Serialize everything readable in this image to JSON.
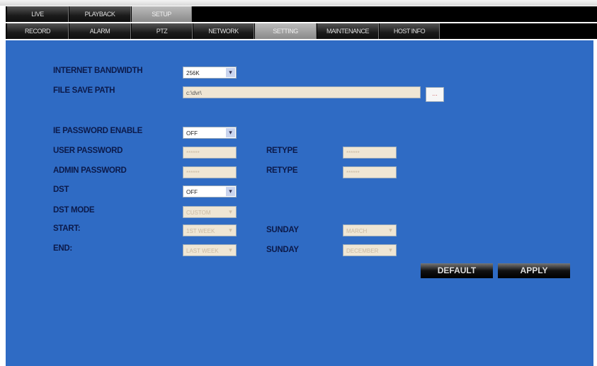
{
  "main_tabs": [
    "LIVE",
    "PLAYBACK",
    "SETUP"
  ],
  "sub_tabs": [
    "RECORD",
    "ALARM",
    "PTZ",
    "NETWORK",
    "SETTING",
    "MAINTENANCE",
    "HOST INFO"
  ],
  "form": {
    "bandwidth_label": "INTERNET BANDWIDTH",
    "bandwidth_value": "256K",
    "path_label": "FILE SAVE PATH",
    "path_value": "c:\\dvr\\",
    "browse_label": "...",
    "ie_pw_label": "IE PASSWORD ENABLE",
    "ie_pw_value": "OFF",
    "user_pw_label": "USER PASSWORD",
    "user_pw_value": "******",
    "admin_pw_label": "ADMIN PASSWORD",
    "admin_pw_value": "******",
    "retype_label": "RETYPE",
    "retype_value": "******",
    "dst_label": "DST",
    "dst_value": "OFF",
    "dst_mode_label": "DST MODE",
    "dst_mode_value": "CUSTOM",
    "start_label": "START:",
    "start_week": "1ST WEEK",
    "start_day": "SUNDAY",
    "start_month": "MARCH",
    "end_label": "END:",
    "end_week": "LAST WEEK",
    "end_day": "SUNDAY",
    "end_month": "DECEMBER"
  },
  "buttons": {
    "default": "DEFAULT",
    "apply": "APPLY"
  },
  "arrow": "▾"
}
